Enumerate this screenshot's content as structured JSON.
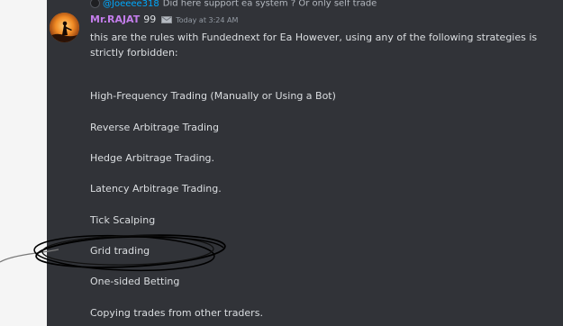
{
  "reply": {
    "username": "@Joeeee318",
    "text": "Did here support ea system ? Or only self trade"
  },
  "message": {
    "username": "Mr.RAJAT",
    "badge": "99",
    "timestamp": "Today at 3:24 AM",
    "intro": "this are the rules with Fundednext for Ea  However, using any of the following strategies is strictly forbidden:",
    "rules": [
      "High-Frequency Trading (Manually or Using a Bot)",
      "Reverse Arbitrage Trading",
      "Hedge Arbitrage Trading.",
      "Latency Arbitrage Trading.",
      "Tick Scalping",
      "Grid trading",
      "One-sided Betting",
      "Copying trades from other traders."
    ]
  },
  "colors": {
    "background": "#313338",
    "username": "#c37dea",
    "reply_username": "#00a8fc",
    "text": "#dbdee1",
    "muted": "#949ba4"
  }
}
